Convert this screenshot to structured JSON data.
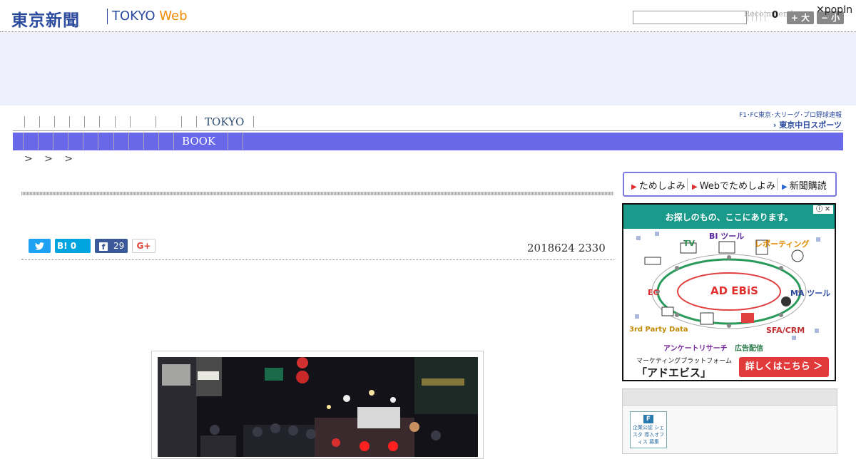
{
  "header": {
    "logo_jp": "東京新聞",
    "logo_tokyo": "TOKYO",
    "logo_web": "Web",
    "recommend_label": "Recommend",
    "count": "0",
    "font_larger": "+ 大",
    "font_smaller": "− 小",
    "popin_label": "✕popIn"
  },
  "nav": {
    "tokyo_label": "TOKYO",
    "book_label": "BOOK",
    "chunichi_sub": "F1･FC東京･大リーグ･プロ野球速報",
    "chunichi_logo": "› 東京中日スポーツ"
  },
  "breadcrumb": ">  >  >",
  "share": {
    "hatena_label": "B! 0",
    "facebook_count": "29",
    "gplus_label": "G+"
  },
  "article": {
    "date": "2018624 2330"
  },
  "sidebar": {
    "trial_items": [
      "ためしよみ",
      "Webでためしよみ",
      "新聞購読"
    ],
    "ad": {
      "headline": "お探しのもの、ここにあります。",
      "close_label": "ⓘ ✕",
      "center_logo": "AD EBiS",
      "labels": [
        "TV",
        "BI ツール",
        "レポーティング",
        "EC",
        "MA ツール",
        "3rd Party Data",
        "SFA/CRM",
        "アンケートリサーチ",
        "広告配信"
      ],
      "foot_sub": "マーケティングプラットフォーム",
      "foot_main": "「アドエビス」",
      "cta": "詳しくはこちら ＞"
    },
    "badge_text": "企業公認 シェスタ 導入オフィス 募集",
    "badge_mark": "F"
  },
  "colors": {
    "brand_blue": "#2a4a9e",
    "brand_orange": "#f08a00",
    "nav_bar": "#6868e8",
    "ad_teal": "#1a9a8a",
    "cta_red": "#e03a3a"
  }
}
